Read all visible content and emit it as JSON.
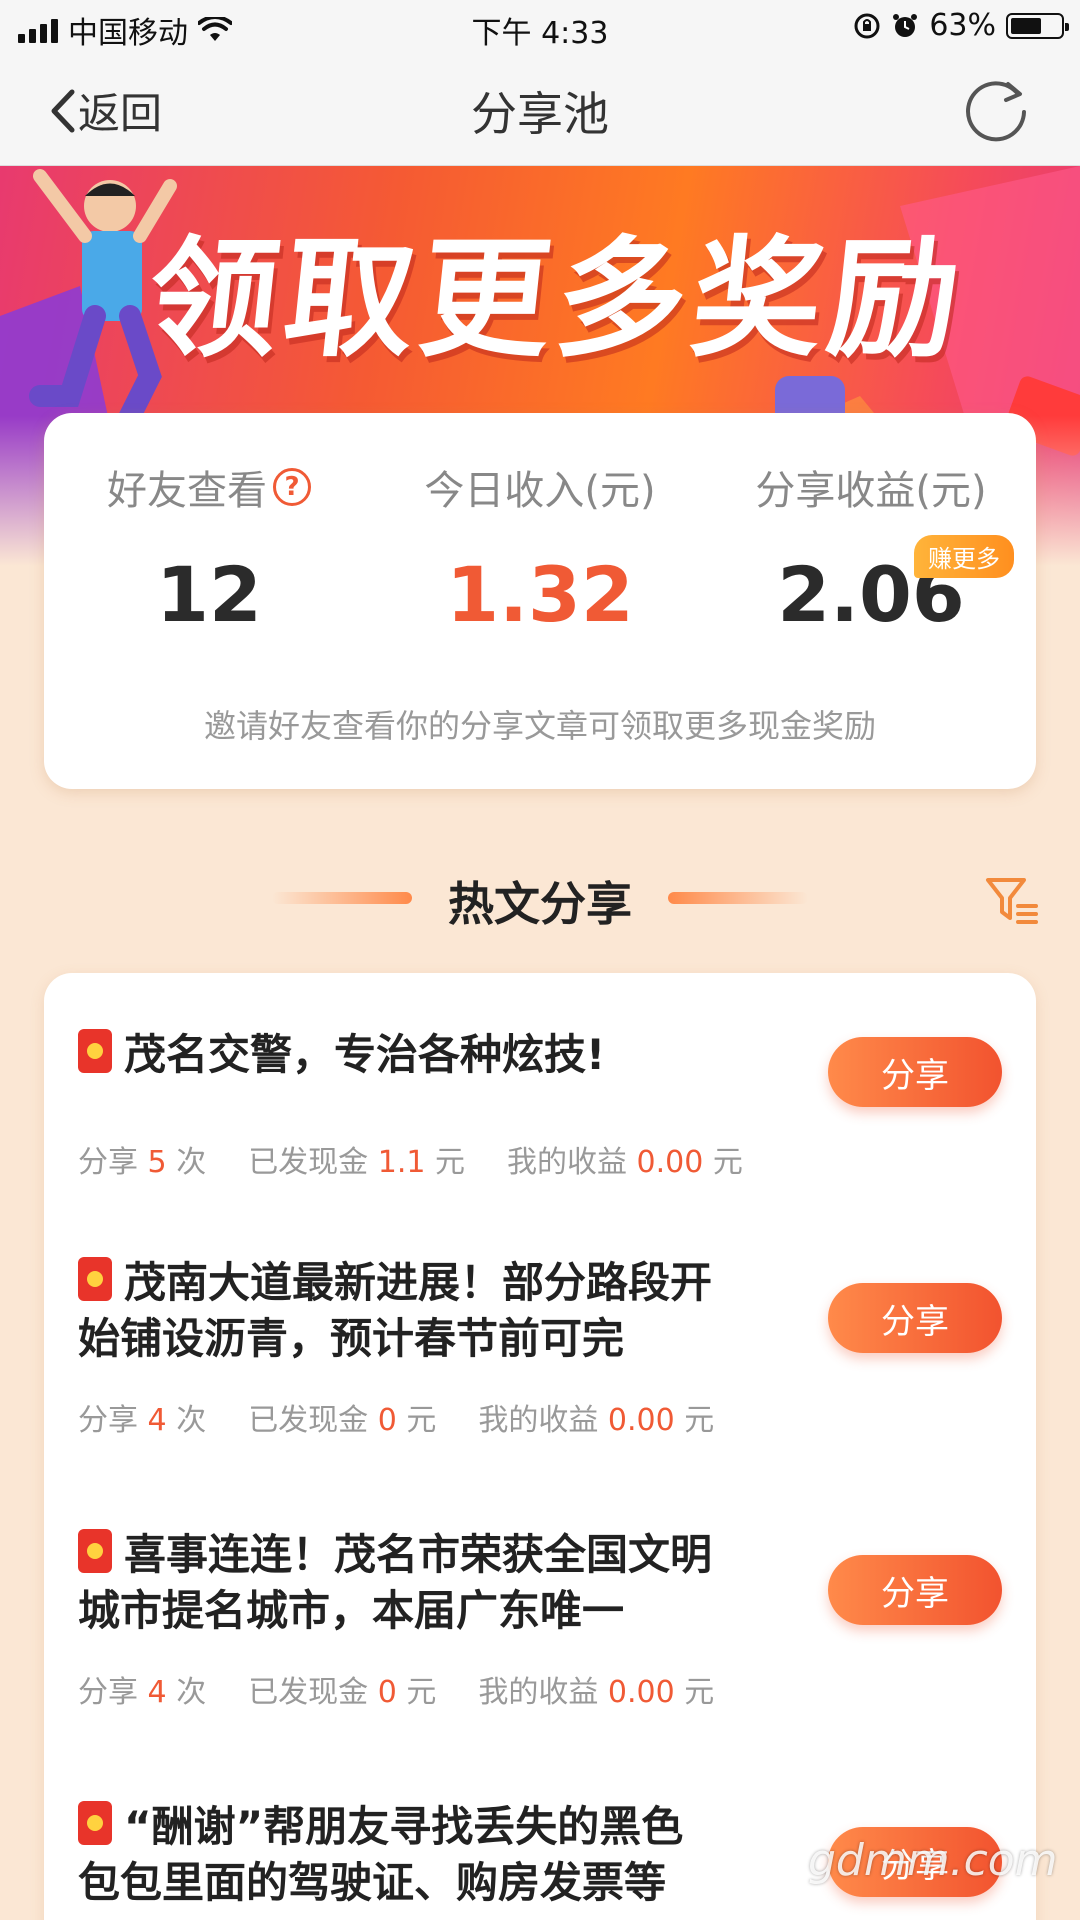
{
  "status_bar": {
    "carrier": "中国移动",
    "time": "下午 4:33",
    "battery": "63%",
    "battery_level": 0.63
  },
  "nav": {
    "back_label": "返回",
    "title": "分享池"
  },
  "banner": {
    "title": "领取更多奖励"
  },
  "stats": {
    "friends_label": "好友查看",
    "friends_value": "12",
    "today_label": "今日收入(元)",
    "today_value": "1.32",
    "share_income_label": "分享收益(元)",
    "share_income_value": "2.06",
    "earn_more_badge": "赚更多",
    "note": "邀请好友查看你的分享文章可领取更多现金奖励"
  },
  "section": {
    "title": "热文分享"
  },
  "articles": [
    {
      "title": "茂名交警，专治各种炫技!",
      "shares_prefix": "分享",
      "shares": "5",
      "shares_suffix": "次",
      "cash_prefix": "已发现金",
      "cash": "1.1",
      "cash_suffix": "元",
      "income_prefix": "我的收益",
      "income": "0.00",
      "income_suffix": "元",
      "button": "分享"
    },
    {
      "title": "茂南大道最新进展！部分路段开始铺设沥青，预计春节前可完",
      "shares_prefix": "分享",
      "shares": "4",
      "shares_suffix": "次",
      "cash_prefix": "已发现金",
      "cash": "0",
      "cash_suffix": "元",
      "income_prefix": "我的收益",
      "income": "0.00",
      "income_suffix": "元",
      "button": "分享"
    },
    {
      "title": "喜事连连！茂名市荣获全国文明城市提名城市，本届广东唯一",
      "shares_prefix": "分享",
      "shares": "4",
      "shares_suffix": "次",
      "cash_prefix": "已发现金",
      "cash": "0",
      "cash_suffix": "元",
      "income_prefix": "我的收益",
      "income": "0.00",
      "income_suffix": "元",
      "button": "分享"
    },
    {
      "title": "“酬谢”帮朋友寻找丢失的黑色包包里面的驾驶证、购房发票等",
      "button": "分享"
    }
  ],
  "watermark": "gdmm.com",
  "colors": {
    "accent": "#f05a35",
    "background": "#fbe7d4",
    "badge": "#ff9a2a"
  }
}
